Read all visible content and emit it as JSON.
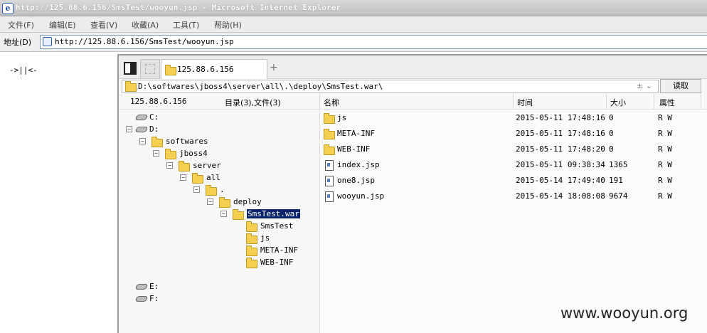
{
  "window": {
    "title": "http://125.88.6.156/SmsTest/wooyun.jsp - Microsoft Internet Explorer"
  },
  "menu": [
    "文件(F)",
    "编辑(E)",
    "查看(V)",
    "收藏(A)",
    "工具(T)",
    "帮助(H)"
  ],
  "address": {
    "label": "地址(D)",
    "url": "http://125.88.6.156/SmsTest/wooyun.jsp"
  },
  "page": {
    "text": "->||<-"
  },
  "shell": {
    "tab_label": "125.88.6.156",
    "tab_add": "+",
    "path": "D:\\softwares\\jboss4\\server\\all\\.\\deploy\\SmsTest.war\\",
    "path_controls": "±  ⌄",
    "read_button": "读取",
    "host": "125.88.6.156",
    "summary": "目录(3),文件(3)",
    "columns": {
      "name": "名称",
      "time": "时间",
      "size": "大小",
      "attr": "属性"
    },
    "tree": [
      {
        "label": "C:",
        "type": "drive",
        "depth": 0,
        "expander": ""
      },
      {
        "label": "D:",
        "type": "drive",
        "depth": 0,
        "expander": "−"
      },
      {
        "label": "softwares",
        "type": "folder",
        "depth": 1,
        "expander": "−"
      },
      {
        "label": "jboss4",
        "type": "folder",
        "depth": 2,
        "expander": "−"
      },
      {
        "label": "server",
        "type": "folder",
        "depth": 3,
        "expander": "−"
      },
      {
        "label": "all",
        "type": "folder",
        "depth": 4,
        "expander": "−"
      },
      {
        "label": ".",
        "type": "folder",
        "depth": 5,
        "expander": "−"
      },
      {
        "label": "deploy",
        "type": "folder",
        "depth": 6,
        "expander": "−"
      },
      {
        "label": "SmsTest.war",
        "type": "folder",
        "depth": 7,
        "expander": "−",
        "selected": true
      },
      {
        "label": "SmsTest",
        "type": "folder",
        "depth": 8,
        "expander": ""
      },
      {
        "label": "js",
        "type": "folder",
        "depth": 8,
        "expander": ""
      },
      {
        "label": "META-INF",
        "type": "folder",
        "depth": 8,
        "expander": ""
      },
      {
        "label": "WEB-INF",
        "type": "folder",
        "depth": 8,
        "expander": ""
      },
      {
        "label": "",
        "type": "spacer",
        "depth": 0,
        "expander": ""
      },
      {
        "label": "E:",
        "type": "drive",
        "depth": 0,
        "expander": ""
      },
      {
        "label": "F:",
        "type": "drive",
        "depth": 0,
        "expander": ""
      }
    ],
    "files": [
      {
        "name": "js",
        "type": "folder",
        "time": "2015-05-11 17:48:16",
        "size": "0",
        "attr": "R W"
      },
      {
        "name": "META-INF",
        "type": "folder",
        "time": "2015-05-11 17:48:16",
        "size": "0",
        "attr": "R W"
      },
      {
        "name": "WEB-INF",
        "type": "folder",
        "time": "2015-05-11 17:48:20",
        "size": "0",
        "attr": "R W"
      },
      {
        "name": "index.jsp",
        "type": "file",
        "time": "2015-05-11 09:38:34",
        "size": "1365",
        "attr": "R W"
      },
      {
        "name": "one8.jsp",
        "type": "file",
        "time": "2015-05-14 17:49:40",
        "size": "191",
        "attr": "R W"
      },
      {
        "name": "wooyun.jsp",
        "type": "file",
        "time": "2015-05-14 18:08:08",
        "size": "9674",
        "attr": "R W"
      }
    ]
  },
  "watermark": "www.wooyun.org",
  "colors": {
    "selection": "#0a246a",
    "folder": "#f5cf4f",
    "frame_bg": "#f8f8f8"
  }
}
